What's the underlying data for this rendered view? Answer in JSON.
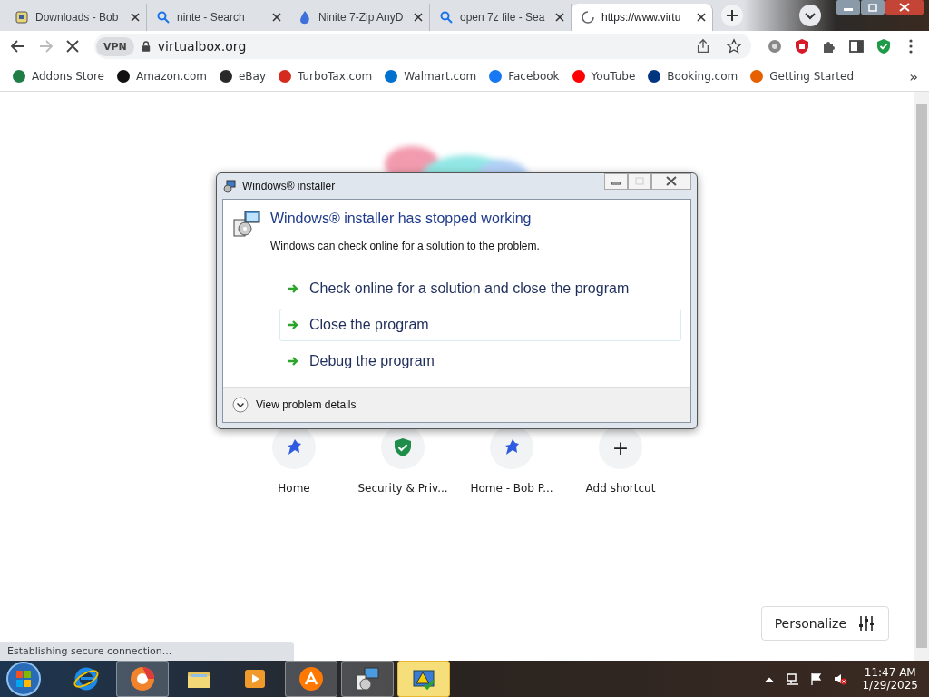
{
  "tabs": [
    {
      "title": "Downloads - Bob",
      "kind": "document",
      "selected": false
    },
    {
      "title": "ninte - Search",
      "kind": "search",
      "selected": false
    },
    {
      "title": "Ninite 7-Zip AnyD",
      "kind": "flame",
      "selected": false
    },
    {
      "title": "open 7z file - Sea",
      "kind": "search",
      "selected": false
    },
    {
      "title": "https://www.virtu",
      "kind": "spinner",
      "selected": true
    }
  ],
  "toolbar": {
    "vpn": "VPN",
    "address": "virtualbox.org"
  },
  "bookmarks": [
    {
      "label": "Addons Store",
      "color": "#1e7e45"
    },
    {
      "label": "Amazon.com",
      "color": "#111111"
    },
    {
      "label": "eBay",
      "color": "#2a2a2a"
    },
    {
      "label": "TurboTax.com",
      "color": "#d52b1e"
    },
    {
      "label": "Walmart.com",
      "color": "#0071ce"
    },
    {
      "label": "Facebook",
      "color": "#1877f2"
    },
    {
      "label": "YouTube",
      "color": "#ff0000"
    },
    {
      "label": "Booking.com",
      "color": "#003580"
    },
    {
      "label": "Getting Started",
      "color": "#e66000"
    }
  ],
  "bookmarks_more": "»",
  "shortcuts": [
    {
      "label": "Home",
      "kind": "site"
    },
    {
      "label": "Security & Priv...",
      "kind": "shield"
    },
    {
      "label": "Home - Bob P...",
      "kind": "site"
    },
    {
      "label": "Add shortcut",
      "kind": "add"
    }
  ],
  "add_glyph": "+",
  "personalize": "Personalize",
  "status": "Establishing secure connection...",
  "dialog": {
    "title": "Windows® installer",
    "heading": "Windows® installer has stopped working",
    "message": "Windows can check online for a solution to the problem.",
    "options": [
      {
        "label": "Check online for a solution and close the program",
        "selected": false
      },
      {
        "label": "Close the program",
        "selected": true
      },
      {
        "label": "Debug the program",
        "selected": false
      }
    ],
    "details": "View problem details"
  },
  "taskbar": {
    "apps": [
      {
        "kind": "ie",
        "running": false,
        "flashing": false
      },
      {
        "kind": "browser",
        "running": true,
        "flashing": false
      },
      {
        "kind": "folder",
        "running": false,
        "flashing": false
      },
      {
        "kind": "media",
        "running": false,
        "flashing": false
      },
      {
        "kind": "avast",
        "running": true,
        "flashing": false
      },
      {
        "kind": "installer",
        "running": true,
        "flashing": false
      },
      {
        "kind": "warning",
        "running": true,
        "flashing": true
      }
    ],
    "time": "11:47 AM",
    "date": "1/29/2025"
  }
}
